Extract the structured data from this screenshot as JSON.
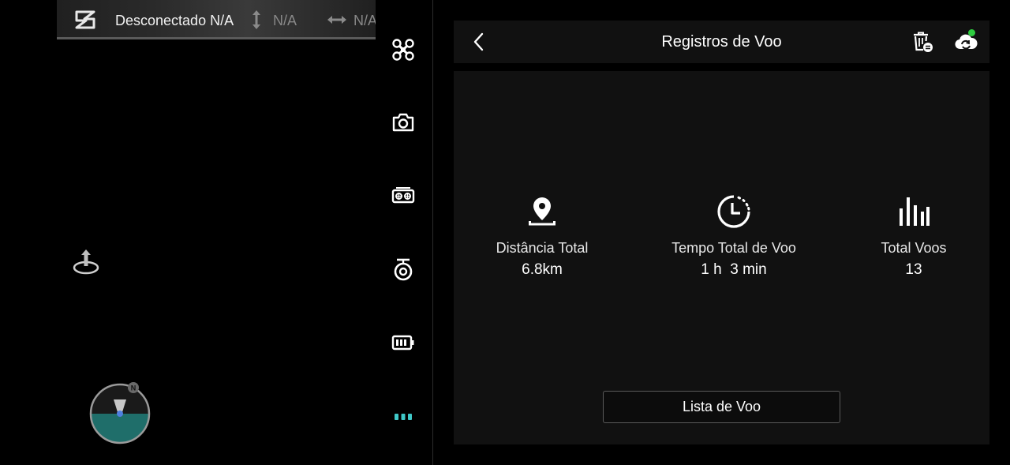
{
  "status_bar": {
    "connection_text": "Desconectado N/A",
    "altitude_text": "N/A",
    "distance_text": "N/A"
  },
  "compass": {
    "north_label": "N"
  },
  "tools": [
    {
      "icon": "drone-icon"
    },
    {
      "icon": "camera-icon"
    },
    {
      "icon": "remote-controller-icon"
    },
    {
      "icon": "gimbal-icon"
    },
    {
      "icon": "battery-icon"
    },
    {
      "icon": "more-icon"
    }
  ],
  "panel": {
    "title": "Registros de Voo",
    "stats": [
      {
        "icon": "location-pin-icon",
        "label": "Distância Total",
        "value": "6.8km"
      },
      {
        "icon": "timer-icon",
        "label": "Tempo Total de Voo",
        "value": "1 h  3 min"
      },
      {
        "icon": "bar-chart-icon",
        "label": "Total Voos",
        "value": "13"
      }
    ],
    "list_button_label": "Lista de Voo"
  },
  "colors": {
    "background": "#000000",
    "panel": "#111111",
    "accent_teal": "#3fc8c8",
    "sync_dot": "#2ecc40",
    "compass_ground": "#1f6e6a"
  }
}
